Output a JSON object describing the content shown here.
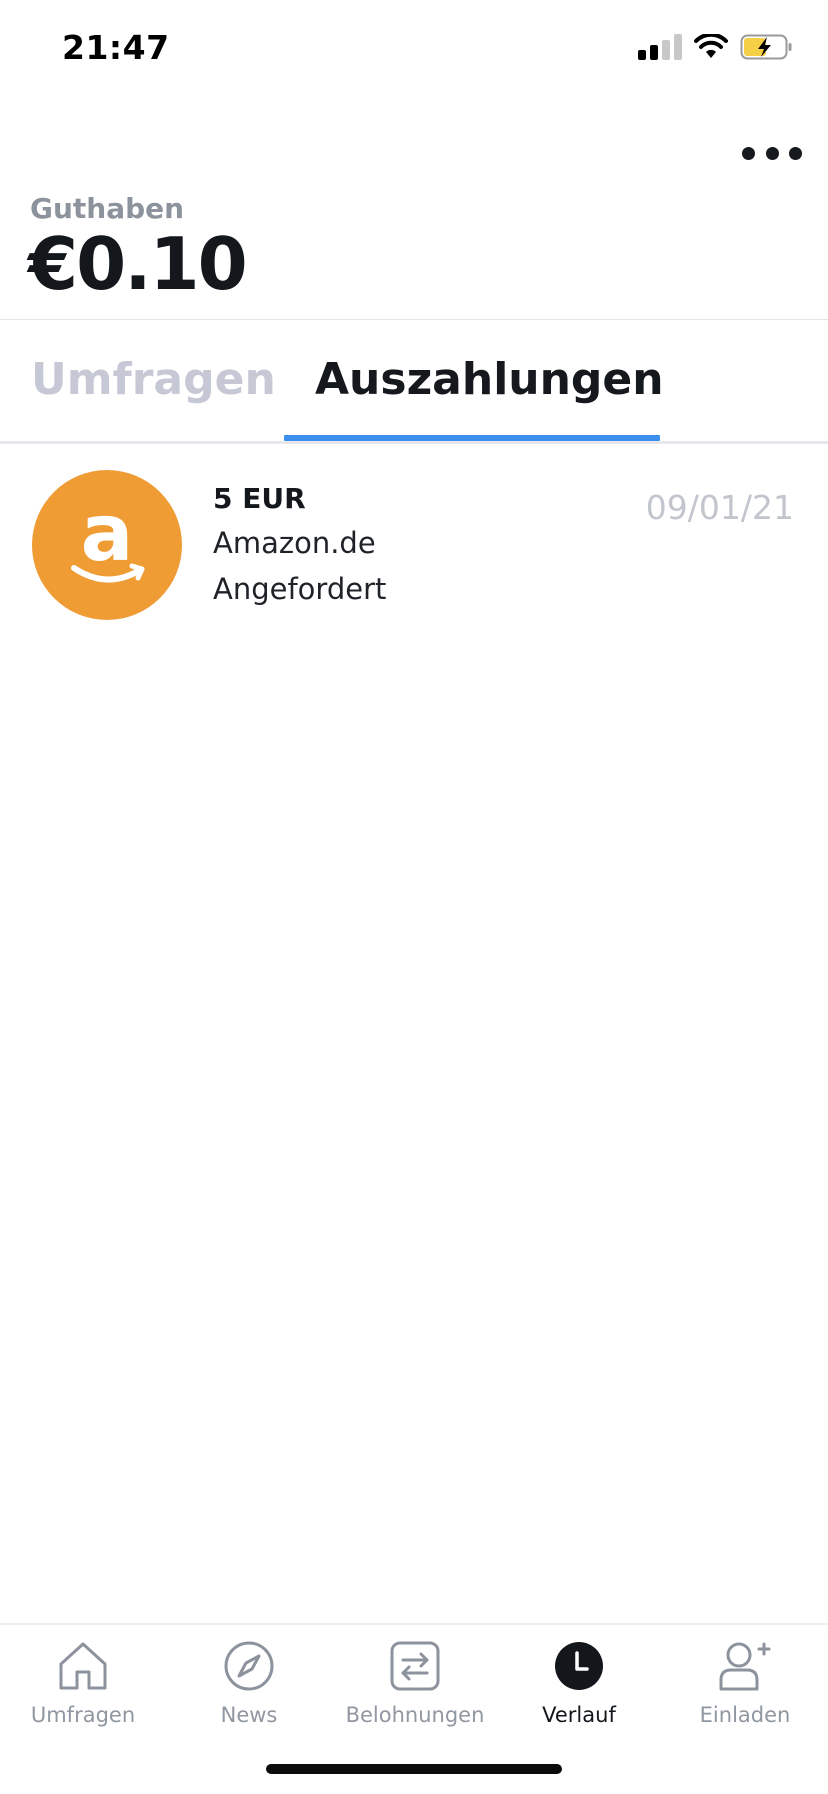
{
  "status_bar": {
    "time": "21:47"
  },
  "header": {
    "more_icon": "more-horizontal-icon",
    "balance_label": "Guthaben",
    "balance_value": "€0.10"
  },
  "tabs": [
    {
      "label": "Umfragen",
      "active": false
    },
    {
      "label": "Auszahlungen",
      "active": true
    }
  ],
  "payouts": [
    {
      "amount": "5 EUR",
      "merchant": "Amazon.de",
      "status": "Angefordert",
      "date": "09/01/21",
      "icon": "amazon-logo"
    }
  ],
  "bottom_nav": [
    {
      "label": "Umfragen",
      "icon": "home-icon",
      "active": false
    },
    {
      "label": "News",
      "icon": "compass-icon",
      "active": false
    },
    {
      "label": "Belohnungen",
      "icon": "exchange-icon",
      "active": false
    },
    {
      "label": "Verlauf",
      "icon": "clock-icon",
      "active": true
    },
    {
      "label": "Einladen",
      "icon": "add-user-icon",
      "active": false
    }
  ],
  "colors": {
    "accent": "#3d8fee",
    "amazon_orange": "#f09c35",
    "inactive_tab": "#c6c8d5",
    "text_dark": "#15191e"
  }
}
